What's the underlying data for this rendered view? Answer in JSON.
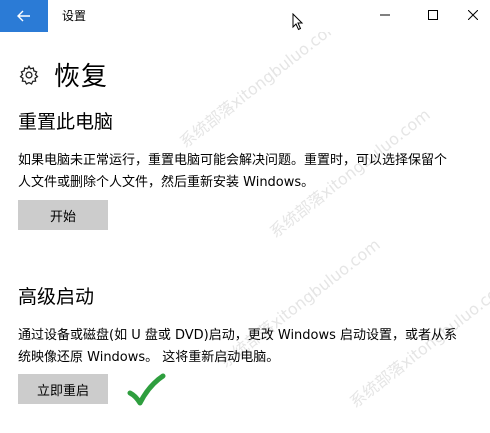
{
  "titlebar": {
    "title": "设置",
    "back_icon": "arrow-left-icon",
    "minimize_icon": "minimize-icon",
    "maximize_icon": "maximize-icon",
    "close_icon": "close-icon",
    "accent_color": "#2b7bd6"
  },
  "page": {
    "title": "恢复",
    "icon": "gear-icon"
  },
  "reset": {
    "title": "重置此电脑",
    "description": "如果电脑未正常运行，重置电脑可能会解决问题。重置时，可以选择保留个人文件或删除个人文件，然后重新安装 Windows。",
    "button_label": "开始"
  },
  "advanced": {
    "title": "高级启动",
    "description": "通过设备或磁盘(如 U 盘或 DVD)启动，更改 Windows 启动设置，或者从系统映像还原 Windows。 这将重新启动电脑。",
    "button_label": "立即重启",
    "check_icon": "checkmark-icon",
    "check_color": "#2e9e3e"
  },
  "watermark": {
    "text": "系统部落xitongbuluo.com"
  }
}
